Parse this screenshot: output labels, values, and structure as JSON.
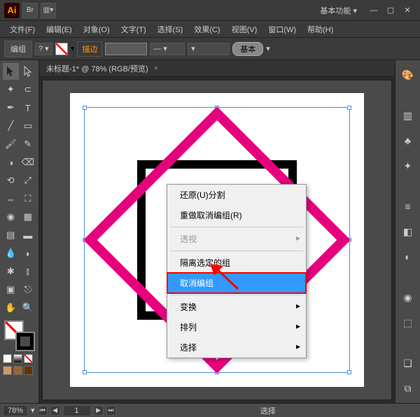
{
  "topbar": {
    "logo": "Ai",
    "br_label": "Br",
    "workspace": "基本功能"
  },
  "menus": [
    "文件(F)",
    "编辑(E)",
    "对象(O)",
    "文字(T)",
    "选择(S)",
    "效果(C)",
    "视图(V)",
    "窗口(W)",
    "帮助(H)"
  ],
  "controlbar": {
    "mode": "编组",
    "stroke_label": "描边",
    "style_label": "基本"
  },
  "doc_tab": {
    "title": "未标题-1* @ 78% (RGB/预览)"
  },
  "context_menu": {
    "items": [
      {
        "label": "还原(U)分割",
        "type": "item"
      },
      {
        "label": "重做取消编组(R)",
        "type": "item"
      },
      {
        "label": "",
        "type": "sep"
      },
      {
        "label": "透视",
        "type": "arrow",
        "dim": true
      },
      {
        "label": "",
        "type": "sep"
      },
      {
        "label": "隔离选定的组",
        "type": "item"
      },
      {
        "label": "取消编组",
        "type": "hl"
      },
      {
        "label": "",
        "type": "sep"
      },
      {
        "label": "变换",
        "type": "arrow"
      },
      {
        "label": "排列",
        "type": "arrow"
      },
      {
        "label": "选择",
        "type": "arrow"
      }
    ]
  },
  "status": {
    "zoom": "78%",
    "page": "1",
    "mode": "选择"
  },
  "colors": {
    "accent": "#e6007e",
    "brand": "#ff9a00"
  },
  "chart_data": null
}
